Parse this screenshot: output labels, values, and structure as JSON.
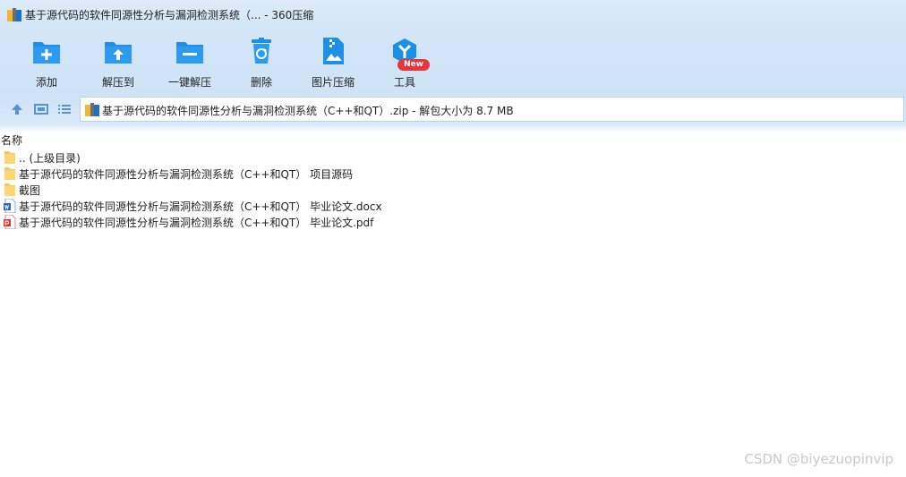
{
  "window": {
    "title": "基于源代码的软件同源性分析与漏洞检测系统（... - 360压缩"
  },
  "toolbar": {
    "items": [
      {
        "label": "添加",
        "icon": "add-folder-icon"
      },
      {
        "label": "解压到",
        "icon": "extract-to-icon"
      },
      {
        "label": "一键解压",
        "icon": "one-click-extract-icon"
      },
      {
        "label": "删除",
        "icon": "recycle-bin-icon"
      },
      {
        "label": "图片压缩",
        "icon": "image-compress-icon"
      },
      {
        "label": "工具",
        "icon": "tools-icon"
      }
    ],
    "badge": "New"
  },
  "address": {
    "path": "基于源代码的软件同源性分析与漏洞检测系统（C++和QT）.zip - 解包大小为 8.7 MB"
  },
  "list": {
    "header": "名称",
    "rows": [
      {
        "name": ".. (上级目录)",
        "type": "folder-up"
      },
      {
        "name": "基于源代码的软件同源性分析与漏洞检测系统（C++和QT） 项目源码",
        "type": "folder"
      },
      {
        "name": "截图",
        "type": "folder"
      },
      {
        "name": "基于源代码的软件同源性分析与漏洞检测系统（C++和QT） 毕业论文.docx",
        "type": "docx"
      },
      {
        "name": "基于源代码的软件同源性分析与漏洞检测系统（C++和QT） 毕业论文.pdf",
        "type": "pdf"
      }
    ]
  },
  "watermark": "CSDN @biyezuopinvip",
  "colors": {
    "accent": "#1e8fe6",
    "badge": "#e8353b",
    "folder": "#f5c85b"
  }
}
